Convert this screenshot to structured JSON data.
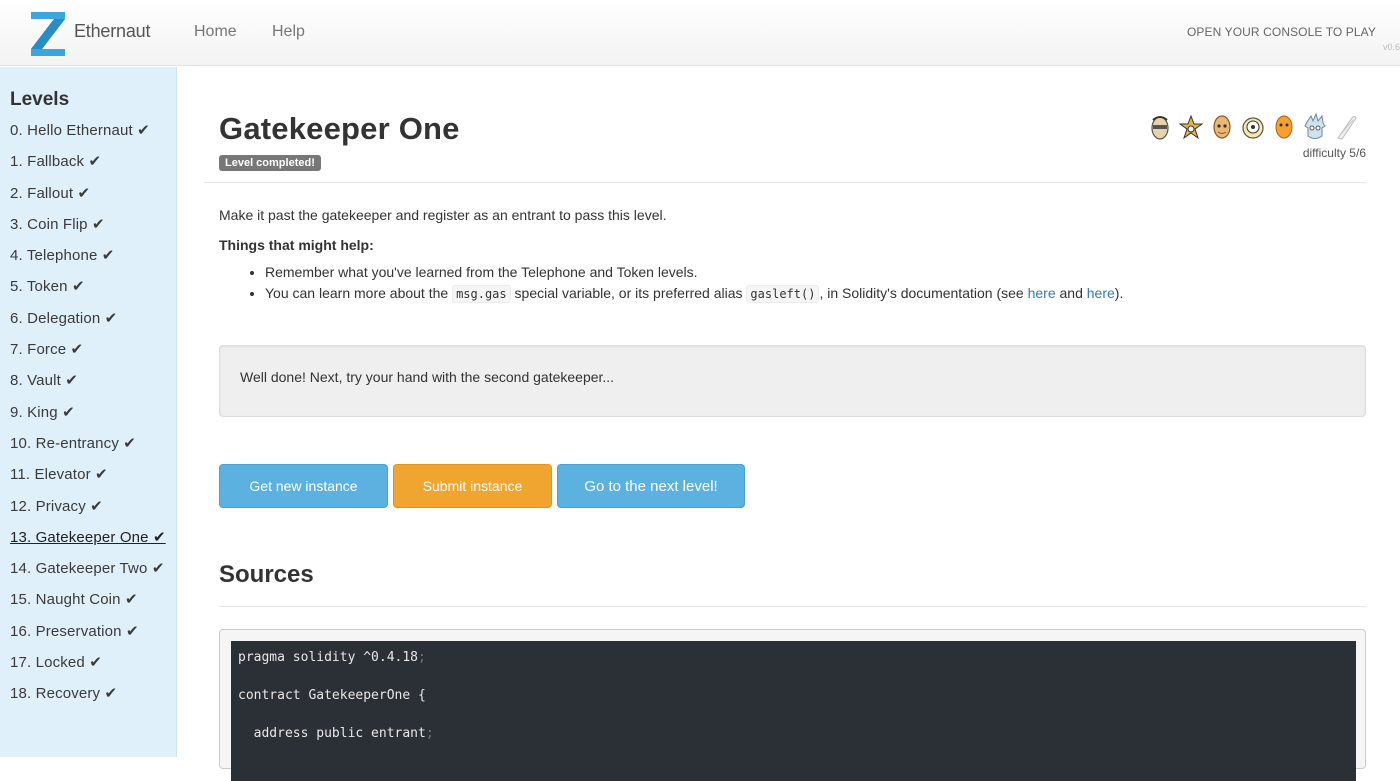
{
  "navbar": {
    "brand": "Ethernaut",
    "links": [
      "Home",
      "Help"
    ],
    "console_message": "OPEN YOUR CONSOLE TO PLAY",
    "version": "v0.6"
  },
  "sidebar": {
    "title": "Levels",
    "levels": [
      "0. Hello Ethernaut ✔",
      "1. Fallback ✔",
      "2. Fallout ✔",
      "3. Coin Flip ✔",
      "4. Telephone ✔",
      "5. Token ✔",
      "6. Delegation ✔",
      "7. Force ✔",
      "8. Vault ✔",
      "9. King ✔",
      "10. Re-entrancy ✔",
      "11. Elevator ✔",
      "12. Privacy ✔",
      "13. Gatekeeper One ✔",
      "14. Gatekeeper Two ✔",
      "15. Naught Coin ✔",
      "16. Preservation ✔",
      "17. Locked ✔",
      "18. Recovery ✔"
    ],
    "active_index": 13
  },
  "level": {
    "title": "Gatekeeper One",
    "badge": "Level completed!",
    "difficulty": "difficulty 5/6",
    "description": "Make it past the gatekeeper and register as an entrant to pass this level.",
    "help_title": "Things that might help:",
    "hint1": "Remember what you've learned from the Telephone and Token levels.",
    "hint2": {
      "part1": "You can learn more about the ",
      "code1": "msg.gas",
      "part2": " special variable, or its preferred alias ",
      "code2": "gasleft()",
      "part3": ", in Solidity's documentation (see ",
      "link1": "here",
      "part4": " and ",
      "link2": "here",
      "part5": ")."
    },
    "completion_message": "Well done! Next, try your hand with the second gatekeeper..."
  },
  "buttons": {
    "new_instance": "Get new instance",
    "submit_instance": "Submit instance",
    "next_level": "Go to the next level!"
  },
  "sources": {
    "title": "Sources",
    "code_lines": [
      {
        "text": "pragma solidity ^0.4.18",
        "end": ";"
      },
      {
        "text": "contract GatekeeperOne {",
        "end": ""
      },
      {
        "text": "  address public entrant",
        "end": ";"
      }
    ]
  },
  "colors": {
    "accent_blue": "#5bb1e0",
    "accent_orange": "#f0a530",
    "sidebar_bg": "#dff0fb",
    "logo_blue": "#3aa6e0"
  },
  "author_icons": [
    "author-avatar-1",
    "author-avatar-2",
    "author-avatar-3",
    "author-avatar-4",
    "author-avatar-5",
    "author-avatar-6",
    "author-avatar-7"
  ]
}
